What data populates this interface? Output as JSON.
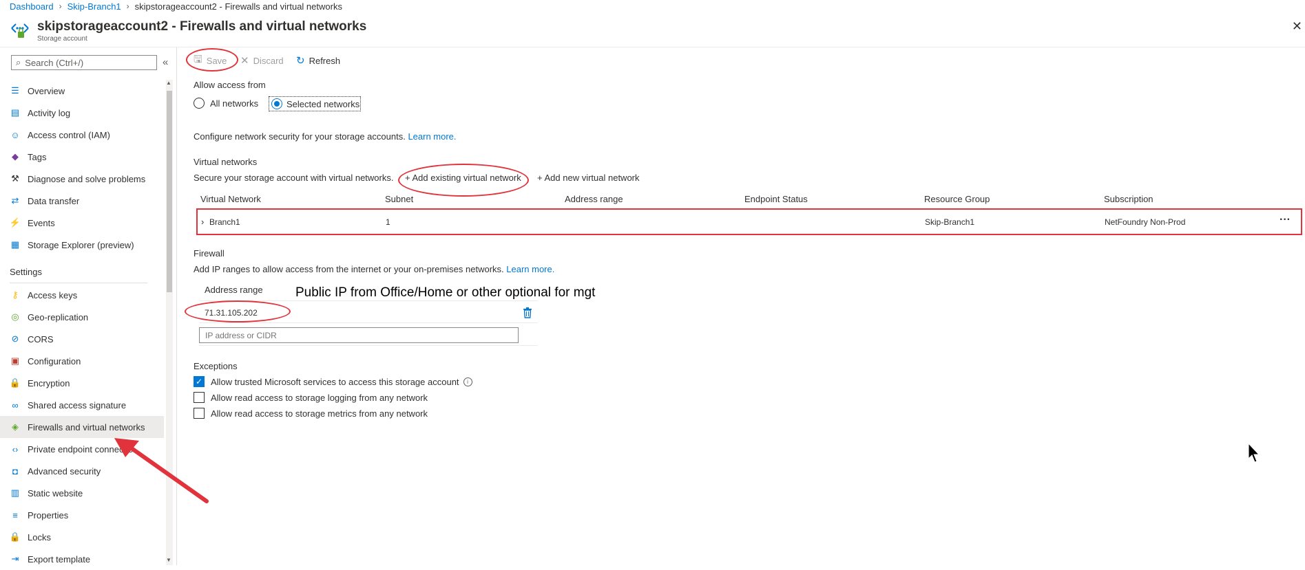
{
  "breadcrumb": [
    "Dashboard",
    "Skip-Branch1",
    "skipstorageaccount2 - Firewalls and virtual networks"
  ],
  "header": {
    "title": "skipstorageaccount2 - Firewalls and virtual networks",
    "subtitle": "Storage account",
    "close_label": "✕"
  },
  "sidebar": {
    "search_placeholder": "Search (Ctrl+/)",
    "collapse_label": "«",
    "items_top": [
      {
        "label": "Overview",
        "icon": "overview-icon"
      },
      {
        "label": "Activity log",
        "icon": "activity-log-icon"
      },
      {
        "label": "Access control (IAM)",
        "icon": "people-icon"
      },
      {
        "label": "Tags",
        "icon": "tag-icon"
      },
      {
        "label": "Diagnose and solve problems",
        "icon": "wrench-icon"
      },
      {
        "label": "Data transfer",
        "icon": "data-transfer-icon"
      },
      {
        "label": "Events",
        "icon": "lightning-icon"
      },
      {
        "label": "Storage Explorer (preview)",
        "icon": "storage-explorer-icon"
      }
    ],
    "settings_heading": "Settings",
    "items_settings": [
      {
        "label": "Access keys",
        "icon": "key-icon"
      },
      {
        "label": "Geo-replication",
        "icon": "globe-icon"
      },
      {
        "label": "CORS",
        "icon": "cors-icon"
      },
      {
        "label": "Configuration",
        "icon": "toolbox-icon"
      },
      {
        "label": "Encryption",
        "icon": "lock-icon"
      },
      {
        "label": "Shared access signature",
        "icon": "link-icon"
      },
      {
        "label": "Firewalls and virtual networks",
        "icon": "firewall-icon"
      },
      {
        "label": "Private endpoint connectio...",
        "icon": "endpoint-icon"
      },
      {
        "label": "Advanced security",
        "icon": "shield-icon"
      },
      {
        "label": "Static website",
        "icon": "website-icon"
      },
      {
        "label": "Properties",
        "icon": "properties-icon"
      },
      {
        "label": "Locks",
        "icon": "lock-icon"
      },
      {
        "label": "Export template",
        "icon": "export-icon"
      }
    ],
    "active_item": "Firewalls and virtual networks"
  },
  "toolbar": {
    "save_label": "Save",
    "discard_label": "Discard",
    "refresh_label": "Refresh"
  },
  "access": {
    "heading": "Allow access from",
    "options": [
      "All networks",
      "Selected networks"
    ],
    "selected": "Selected networks"
  },
  "configure": {
    "text": "Configure network security for your storage accounts.",
    "link": "Learn more."
  },
  "vnet": {
    "heading": "Virtual networks",
    "description": "Secure your storage account with virtual networks.",
    "add_existing": "+ Add existing virtual network",
    "add_new": "+ Add new virtual network",
    "columns": [
      "Virtual Network",
      "Subnet",
      "Address range",
      "Endpoint Status",
      "Resource Group",
      "Subscription"
    ],
    "rows": [
      {
        "virtual_network": "Branch1",
        "subnet": "1",
        "address_range": "",
        "endpoint_status": "",
        "resource_group": "Skip-Branch1",
        "subscription": "NetFoundry Non-Prod",
        "more": "···"
      }
    ]
  },
  "firewall": {
    "heading": "Firewall",
    "description": "Add IP ranges to allow access from the internet or your on-premises networks.",
    "link": "Learn more.",
    "column": "Address range",
    "entries": [
      "71.31.105.202"
    ],
    "input_placeholder": "IP address or CIDR"
  },
  "annotation": "Public IP from Office/Home or other optional for mgt",
  "exceptions": {
    "heading": "Exceptions",
    "items": [
      {
        "label": "Allow trusted Microsoft services to access this storage account",
        "checked": true
      },
      {
        "label": "Allow read access to storage logging from any network",
        "checked": false
      },
      {
        "label": "Allow read access to storage metrics from any network",
        "checked": false
      }
    ]
  },
  "colors": {
    "accent": "#0078d4",
    "annotation_red": "#e0333b",
    "active_bg": "#edebe9"
  }
}
